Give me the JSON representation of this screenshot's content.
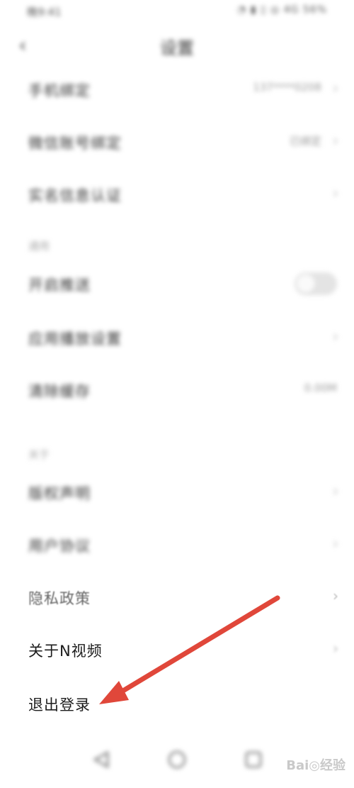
{
  "status_bar": {
    "time": "晚9:41",
    "icons": "◔ ▮ ▯ ◎ 4G 56%"
  },
  "header": {
    "title": "设置",
    "back_icon": "chevron-left-icon"
  },
  "rows_top": [
    {
      "label": "手机绑定",
      "value": "137****0208",
      "chevron": "›"
    },
    {
      "label": "微信账号绑定",
      "value": "已绑定",
      "chevron": "›"
    },
    {
      "label": "实名信息认证",
      "value": "",
      "chevron": "›"
    }
  ],
  "section_general": "通用",
  "rows_general": [
    {
      "label": "开启推送",
      "toggle": false
    },
    {
      "label": "应用播放设置",
      "value": "",
      "chevron": "›"
    },
    {
      "label": "清除缓存",
      "value": "0.00M",
      "chevron": ""
    }
  ],
  "section_about": "关于",
  "rows_about": [
    {
      "label": "版权声明",
      "chevron": "›"
    },
    {
      "label": "用户协议",
      "chevron": "›"
    },
    {
      "label": "隐私政策",
      "chevron": "›"
    },
    {
      "label": "关于N视频",
      "chevron": "›"
    },
    {
      "label": "退出登录",
      "chevron": ""
    }
  ],
  "nav": {
    "back_icon": "triangle-back-icon",
    "home_icon": "circle-home-icon",
    "recent_icon": "square-recent-icon"
  },
  "watermark": "Bai◎经验",
  "colors": {
    "arrow": "#e0473a",
    "background": "#ffffff"
  }
}
